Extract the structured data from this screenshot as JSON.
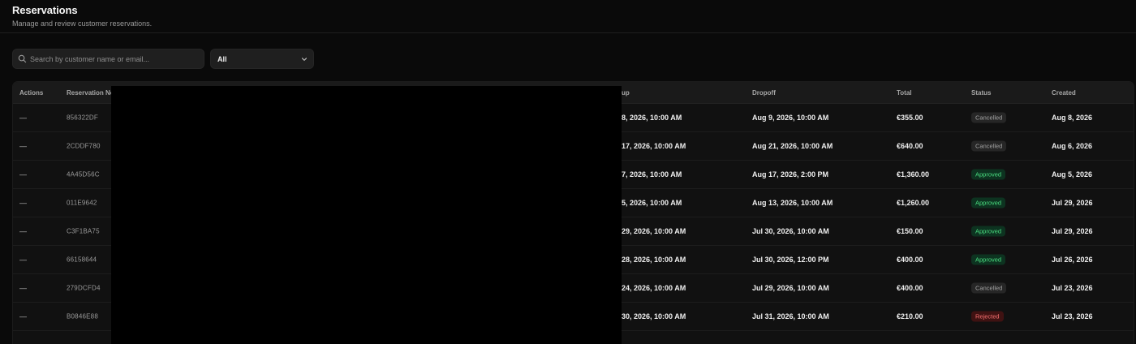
{
  "header": {
    "title": "Reservations",
    "subtitle": "Manage and review customer reservations."
  },
  "filters": {
    "search_placeholder": "Search by customer name or email...",
    "status_selected": "All"
  },
  "table": {
    "columns": {
      "actions": "Actions",
      "reservation_no": "Reservation No",
      "pickup": "up",
      "dropoff": "Dropoff",
      "total": "Total",
      "status": "Status",
      "created": "Created"
    },
    "rows": [
      {
        "action": "—",
        "reservation_no": "856322DF",
        "pickup": "8, 2026, 10:00 AM",
        "dropoff": "Aug 9, 2026, 10:00 AM",
        "total": "€355.00",
        "status": "Cancelled",
        "status_kind": "cancelled",
        "created": "Aug 8, 2026"
      },
      {
        "action": "—",
        "reservation_no": "2CDDF780",
        "pickup": "17, 2026, 10:00 AM",
        "dropoff": "Aug 21, 2026, 10:00 AM",
        "total": "€640.00",
        "status": "Cancelled",
        "status_kind": "cancelled",
        "created": "Aug 6, 2026"
      },
      {
        "action": "—",
        "reservation_no": "4A45D56C",
        "pickup": "7, 2026, 10:00 AM",
        "dropoff": "Aug 17, 2026, 2:00 PM",
        "total": "€1,360.00",
        "status": "Approved",
        "status_kind": "approved",
        "created": "Aug 5, 2026"
      },
      {
        "action": "—",
        "reservation_no": "011E9642",
        "pickup": "5, 2026, 10:00 AM",
        "dropoff": "Aug 13, 2026, 10:00 AM",
        "total": "€1,260.00",
        "status": "Approved",
        "status_kind": "approved",
        "created": "Jul 29, 2026"
      },
      {
        "action": "—",
        "reservation_no": "C3F1BA75",
        "pickup": "29, 2026, 10:00 AM",
        "dropoff": "Jul 30, 2026, 10:00 AM",
        "total": "€150.00",
        "status": "Approved",
        "status_kind": "approved",
        "created": "Jul 29, 2026"
      },
      {
        "action": "—",
        "reservation_no": "66158644",
        "pickup": "28, 2026, 10:00 AM",
        "dropoff": "Jul 30, 2026, 12:00 PM",
        "total": "€400.00",
        "status": "Approved",
        "status_kind": "approved",
        "created": "Jul 26, 2026"
      },
      {
        "action": "—",
        "reservation_no": "279DCFD4",
        "pickup": "24, 2026, 10:00 AM",
        "dropoff": "Jul 29, 2026, 10:00 AM",
        "total": "€400.00",
        "status": "Cancelled",
        "status_kind": "cancelled",
        "created": "Jul 23, 2026"
      },
      {
        "action": "—",
        "reservation_no": "B0846E88",
        "pickup": "30, 2026, 10:00 AM",
        "dropoff": "Jul 31, 2026, 10:00 AM",
        "total": "€210.00",
        "status": "Rejected",
        "status_kind": "rejected",
        "created": "Jul 23, 2026"
      }
    ]
  },
  "icons": {
    "search": "search-icon",
    "chevron": "chevron-down-icon"
  },
  "colors": {
    "background": "#0a0a0a",
    "approved": "#4ade80",
    "rejected": "#f87171",
    "cancelled": "#a3a3a3"
  }
}
